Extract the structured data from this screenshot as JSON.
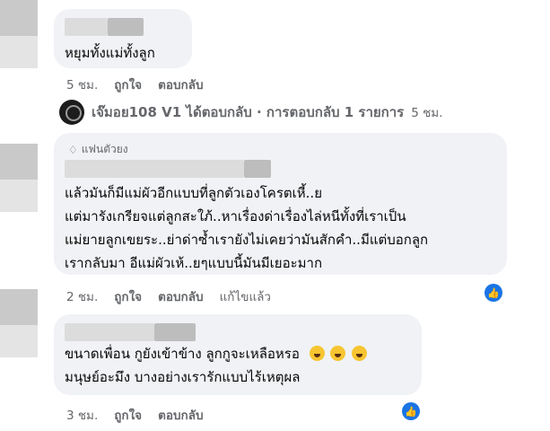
{
  "comment1": {
    "text": "หยุมทั้งแม่ทั้งลูก",
    "time": "5 ชม.",
    "like": "ถูกใจ",
    "reply": "ตอบกลับ"
  },
  "reply_summary": {
    "text": "เจ๊มอย108 V1 ได้ตอบกลับ · การตอบกลับ 1 รายการ",
    "time": "5 ชม."
  },
  "comment2": {
    "badge": "แฟนตัวยง",
    "lines": [
      "แล้วมันก็มีแม่ผัวอีกแบบที่ลูกตัวเองโครตเหี้..ย",
      "แต่มารังเกรียจแต่ลูกสะใภ้..หาเรื่องด่าเรื่องไล่หนีทั้งที่เราเป็น",
      "แม่ยายลูกเขยระ..ย่าด่าซ้ำเรายังไม่เคยว่ามันสักคำ..มีแต่บอกลูก",
      "เรากลับมา อีแม่ผัวเห้..ยๆแบบนี้มันมีเยอะมาก"
    ],
    "time": "2 ชม.",
    "like": "ถูกใจ",
    "reply": "ตอบกลับ",
    "edited": "แก้ไขแล้ว"
  },
  "comment3": {
    "line1": "ขนาดเพื่อน กูยังเข้าข้าง ลูกกูจะเหลือหรอ",
    "line2": "มนุษย์อะมึง บางอย่างเรารักแบบไร้เหตุผล",
    "time": "3 ชม.",
    "like": "ถูกใจ",
    "reply": "ตอบกลับ"
  },
  "icons": {
    "like_reaction": "thumbs-up-icon",
    "emoji": "laughing-crying-emoji-icon",
    "badge": "diamond-icon",
    "accent": "#1b74e4"
  }
}
